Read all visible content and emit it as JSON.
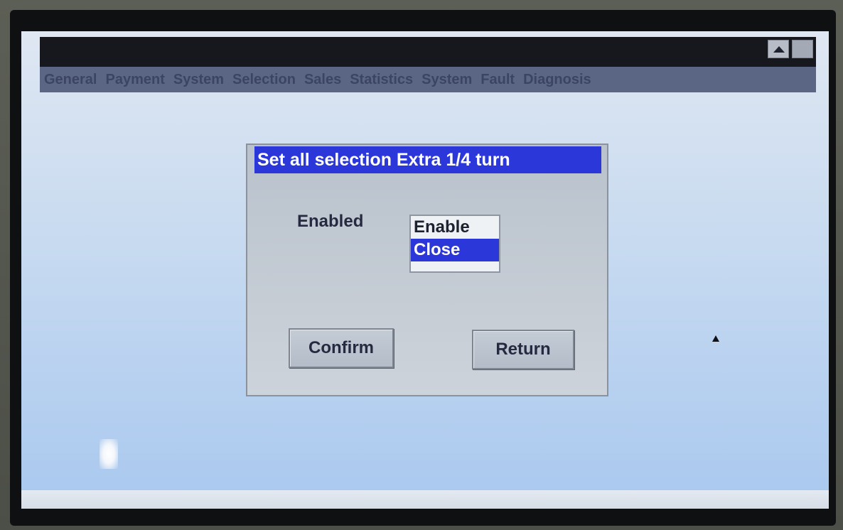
{
  "window": {
    "buttons": {
      "scroll_up_icon": "triangle-up-icon",
      "square_icon": "square-icon"
    }
  },
  "menu": {
    "items": [
      "General",
      "Payment",
      "System",
      "Selection",
      "Sales",
      "Statistics",
      "System",
      "Fault",
      "Diagnosis"
    ]
  },
  "dialog": {
    "title": "Set all selection Extra 1/4 turn",
    "field_label": "Enabled",
    "options": [
      "Enable",
      "Close"
    ],
    "selected_option": "Close",
    "confirm_label": "Confirm",
    "return_label": "Return"
  },
  "colors": {
    "title_bar": "#16181d",
    "menu_bar": "#5b6685",
    "dialog_title": "#2b37d8",
    "selection_highlight": "#2b37d8"
  }
}
